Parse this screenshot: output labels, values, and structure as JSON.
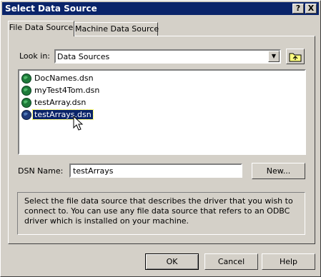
{
  "window": {
    "title": "Select Data Source"
  },
  "titlebar": {
    "help_label": "?",
    "close_label": "X"
  },
  "tabs": [
    {
      "label": "File Data Source",
      "active": true
    },
    {
      "label": "Machine Data Source",
      "active": false
    }
  ],
  "look_in": {
    "label": "Look in:",
    "value": "Data Sources"
  },
  "files": [
    {
      "name": "DocNames.dsn",
      "selected": false
    },
    {
      "name": "myTest4Tom.dsn",
      "selected": false
    },
    {
      "name": "testArray.dsn",
      "selected": false
    },
    {
      "name": "testArrays.dsn",
      "selected": true
    }
  ],
  "dsn": {
    "label": "DSN Name:",
    "value": "testArrays",
    "new_label": "New..."
  },
  "description": "Select the file data source that describes the driver that you wish to connect to. You can use any file data source that refers to an ODBC driver which is installed on your machine.",
  "buttons": {
    "ok": "OK",
    "cancel": "Cancel",
    "help": "Help"
  },
  "colors": {
    "titlebar": "#0a246a",
    "selection": "#0a246a",
    "face": "#d4d0c8"
  }
}
